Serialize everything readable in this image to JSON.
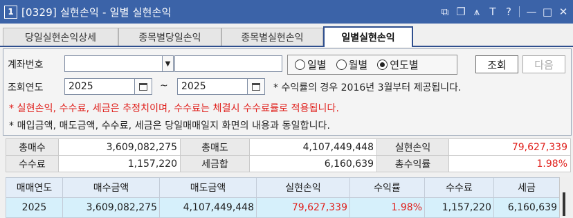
{
  "window": {
    "number": "1",
    "title": "[0329] 실현손익 - 일별 실현손익",
    "icons": [
      "restore-icon",
      "new-window-icon",
      "pin-icon",
      "text-size-icon",
      "help-icon",
      "minimize-icon",
      "maximize-icon",
      "close-icon"
    ]
  },
  "tabs": [
    {
      "label": "당일실현손익상세",
      "active": false
    },
    {
      "label": "종목별당일손익",
      "active": false
    },
    {
      "label": "종목별실현손익",
      "active": false
    },
    {
      "label": "일별실현손익",
      "active": true
    }
  ],
  "query": {
    "account_label": "계좌번호",
    "account_value": "",
    "account_name": "",
    "period_options": [
      "일별",
      "월별",
      "연도별"
    ],
    "period_selected": "연도별",
    "search_button": "조회",
    "next_button": "다음",
    "year_label": "조회연도",
    "year_from": "2025",
    "tilde": "~",
    "year_to": "2025",
    "rate_note": "* 수익률의 경우 2016년 3월부터 제공됩니다.",
    "warning_note": "* 실현손익, 수수료, 세금은 추정치이며, 수수료는 체결시 수수료률로 적용됩니다.",
    "info_note": "* 매입금액, 매도금액, 수수료, 세금은 당일매매일지 화면의 내용과 동일합니다."
  },
  "summary": {
    "total_buy_label": "총매수",
    "total_buy": "3,609,082,275",
    "total_sell_label": "총매도",
    "total_sell": "4,107,449,448",
    "realized_label": "실현손익",
    "realized": "79,627,339",
    "fee_label": "수수료",
    "fee": "1,157,220",
    "tax_label": "세금합",
    "tax": "6,160,639",
    "return_label": "총수익률",
    "return": "1.98%"
  },
  "grid": {
    "headers": [
      "매매연도",
      "매수금액",
      "매도금액",
      "실현손익",
      "수익률",
      "수수료",
      "세금"
    ],
    "rows": [
      [
        "2025",
        "3,609,082,275",
        "4,107,449,448",
        "79,627,339",
        "1.98%",
        "1,157,220",
        "6,160,639"
      ]
    ]
  },
  "colors": {
    "titlebar": "#3b63a8",
    "profit": "#e0201c",
    "row_highlight": "#d6f0fb"
  }
}
